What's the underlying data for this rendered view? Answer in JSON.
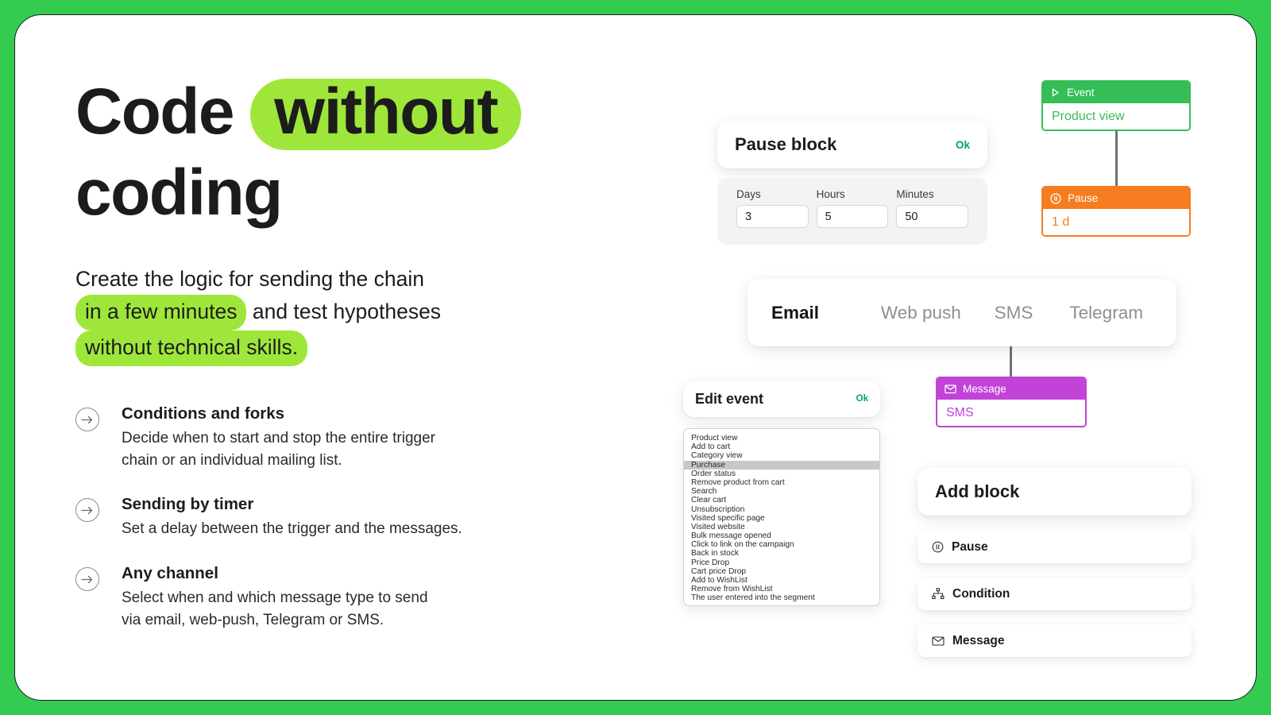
{
  "theme": {
    "page_bg": "#33cb50",
    "card_bg": "#ffffff",
    "highlight_green": "#9fe63b",
    "ok_green": "#00a36a",
    "event_green": "#35bd58",
    "pause_orange": "#f57c1f",
    "message_purple": "#c143d8",
    "connector_gray": "#6d7278"
  },
  "hero": {
    "headline_part1": "Code",
    "headline_highlight": "without",
    "headline_part2": "coding",
    "subhead_line1": "Create the logic for sending the chain",
    "subhead_highlight1": "in a few minutes",
    "subhead_mid": "and test hypotheses",
    "subhead_highlight2": "without technical skills."
  },
  "features": [
    {
      "icon": "arrow-right-circle-icon",
      "title": "Conditions and forks",
      "desc": "Decide when to start and stop the entire trigger\nchain or an individual mailing list."
    },
    {
      "icon": "arrow-right-circle-icon",
      "title": "Sending by timer",
      "desc": "Set a delay between the trigger and the messages."
    },
    {
      "icon": "arrow-right-circle-icon",
      "title": "Any channel",
      "desc": "Select when and which message type to send\nvia email, web-push, Telegram or SMS."
    }
  ],
  "pause_block": {
    "title": "Pause block",
    "ok_label": "Ok",
    "fields": [
      {
        "label": "Days",
        "value": "3"
      },
      {
        "label": "Hours",
        "value": "5"
      },
      {
        "label": "Minutes",
        "value": "50"
      }
    ]
  },
  "flow": {
    "event_node": {
      "icon": "play-triangle-icon",
      "header": "Event",
      "value": "Product view"
    },
    "pause_node": {
      "icon": "pause-circle-icon",
      "header": "Pause",
      "value": "1 d"
    },
    "message_node": {
      "icon": "envelope-icon",
      "header": "Message",
      "value": "SMS"
    }
  },
  "channel_tabs": {
    "tabs": [
      {
        "label": "Email",
        "active": true
      },
      {
        "label": "Web push",
        "active": false
      },
      {
        "label": "SMS",
        "active": false
      },
      {
        "label": "Telegram",
        "active": false
      }
    ]
  },
  "edit_event": {
    "title": "Edit event",
    "ok_label": "Ok",
    "selected": "Purchase",
    "options": [
      "Product view",
      "Add to cart",
      "Category view",
      "Purchase",
      "Order status",
      "Remove product from cart",
      "Search",
      "Clear cart",
      "Unsubscription",
      "Visited specific page",
      "Visited website",
      "Bulk message opened",
      "Click to link on the campaign",
      "Back in stock",
      "Price Drop",
      "Cart price Drop",
      "Add to WishList",
      "Remove from WishList",
      "The user entered into the segment"
    ]
  },
  "add_block": {
    "title": "Add block",
    "items": [
      {
        "icon": "pause-circle-icon",
        "label": "Pause"
      },
      {
        "icon": "condition-tree-icon",
        "label": "Condition"
      },
      {
        "icon": "envelope-icon",
        "label": "Message"
      }
    ]
  }
}
